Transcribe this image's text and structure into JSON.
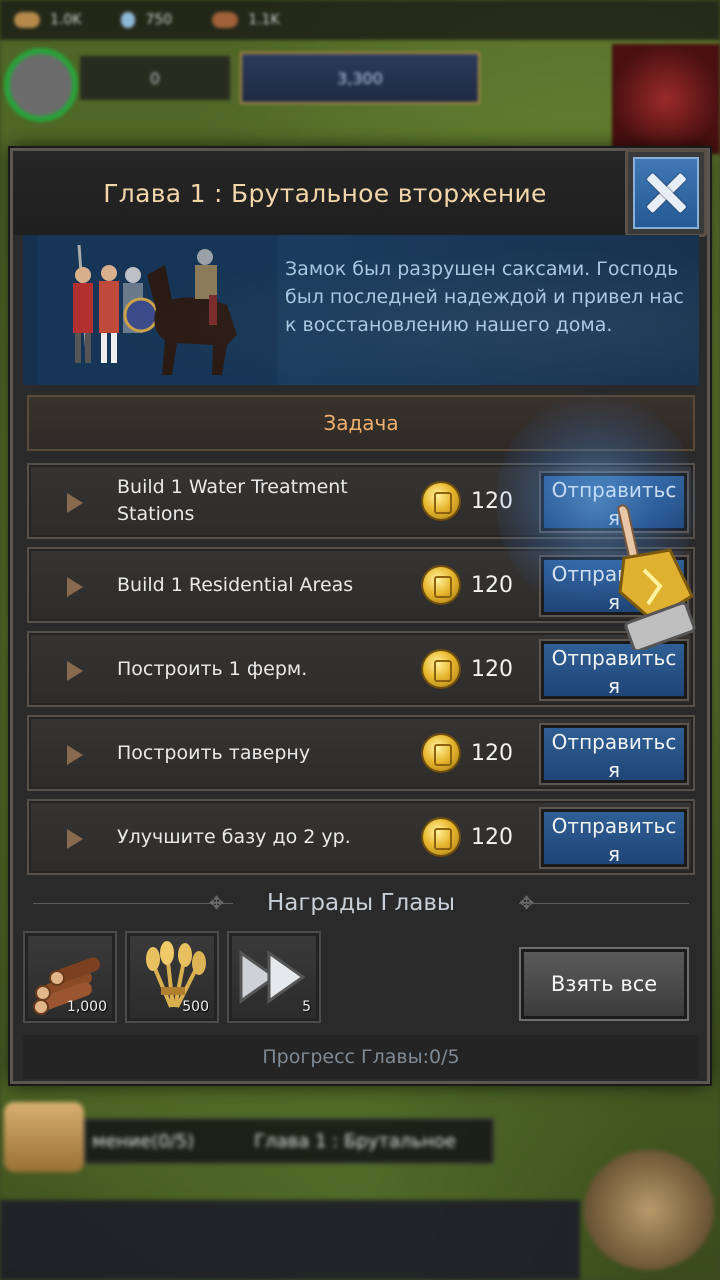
{
  "top_resources": [
    {
      "icon": "gold-icon",
      "value": "1.0K"
    },
    {
      "icon": "water-drop-icon",
      "value": "750"
    },
    {
      "icon": "wood-icon",
      "value": "1.1K"
    }
  ],
  "hud": {
    "power": "0",
    "troops": "3,300"
  },
  "dialog": {
    "title": "Глава 1 : Брутальное вторжение",
    "description": "Замок был разрушен саксами. Господь был последней надеждой и привел нас к восстановлению нашего дома.",
    "task_header": "Задача",
    "tasks": [
      {
        "label": "Build 1 Water Treatment Stations",
        "reward": "120",
        "button": "Отправиться"
      },
      {
        "label": "Build 1 Residential Areas",
        "reward": "120",
        "button": "Отправиться"
      },
      {
        "label": "Построить 1 ферм.",
        "reward": "120",
        "button": "Отправиться"
      },
      {
        "label": "Построить таверну",
        "reward": "120",
        "button": "Отправиться"
      },
      {
        "label": "Улучшите базу до 2 ур.",
        "reward": "120",
        "button": "Отправиться"
      }
    ],
    "rewards_title": "Награды Главы",
    "rewards": [
      {
        "icon": "wood-logs-icon",
        "qty": "1,000"
      },
      {
        "icon": "wheat-icon",
        "qty": "500"
      },
      {
        "icon": "speedup-icon",
        "qty": "5"
      }
    ],
    "claim_all": "Взять все",
    "progress": "Прогресс Главы:0/5"
  },
  "bottom": {
    "quest_strip_left": "мение(0/5)",
    "quest_strip_right": "Глава 1 : Брутальное"
  },
  "colors": {
    "title": "#f2d6a8",
    "task_header": "#f0b070",
    "button_blue": "#2f5f95",
    "coin": "#e8b830"
  }
}
